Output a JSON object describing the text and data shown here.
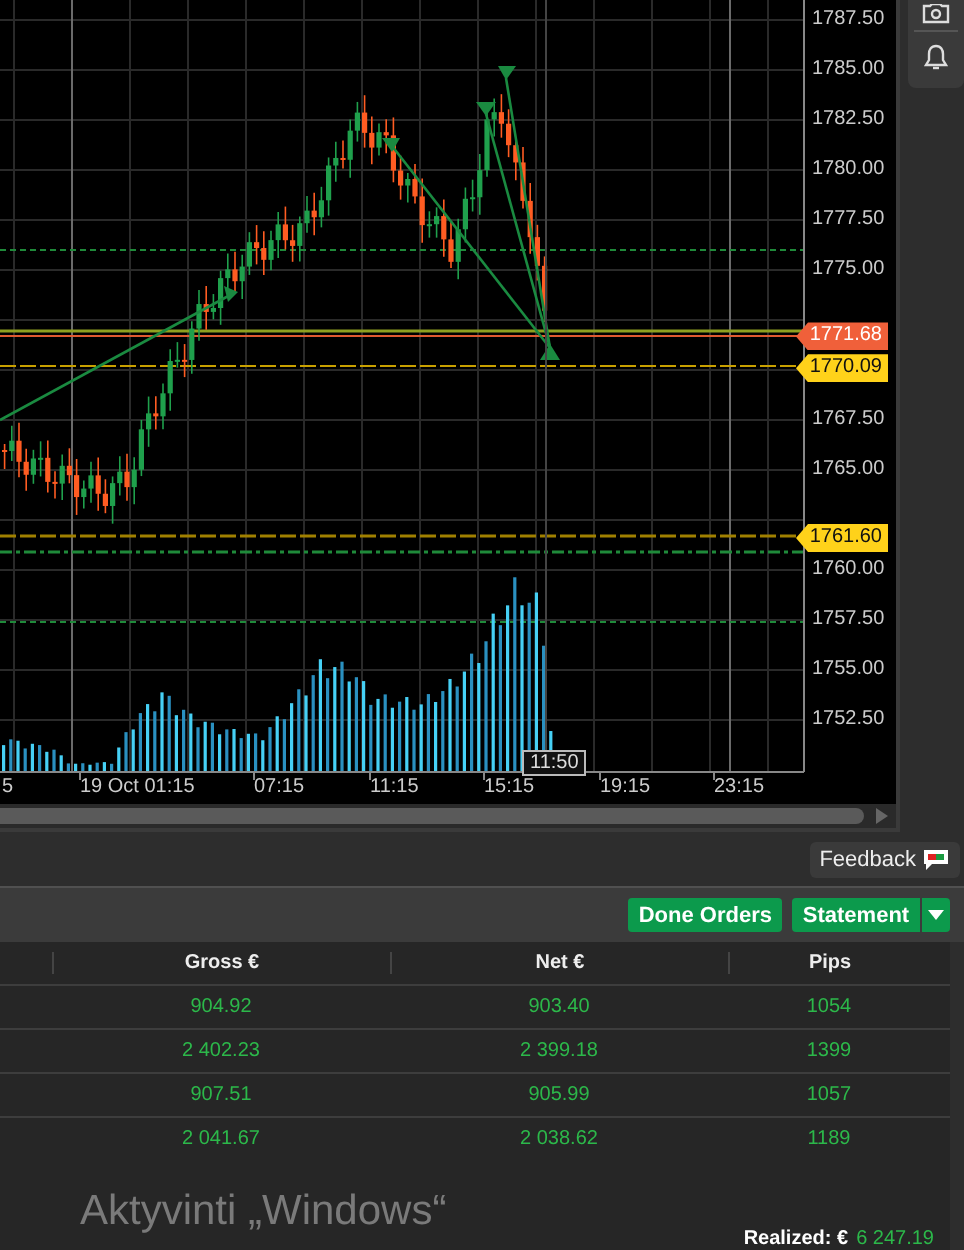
{
  "chart": {
    "price_labels": [
      "1787.50",
      "1785.00",
      "1782.50",
      "1780.00",
      "1777.50",
      "1775.00",
      "1767.50",
      "1765.00",
      "1760.00",
      "1757.50",
      "1755.00",
      "1752.50"
    ],
    "price_markers": [
      {
        "label": "1771.68",
        "kind": "bid"
      },
      {
        "label": "1770.09",
        "kind": "order"
      },
      {
        "label": "1761.60",
        "kind": "order"
      }
    ],
    "time_labels": [
      "5",
      "19 Oct 01:15",
      "07:15",
      "11:15",
      "15:15",
      "19:15",
      "23:15"
    ],
    "cursor_time": "11:50"
  },
  "feedback_button": {
    "label": "Feedback"
  },
  "orders_panel": {
    "buttons": [
      {
        "label": "Done Orders",
        "kind": "button"
      },
      {
        "label": "Statement",
        "kind": "split"
      }
    ],
    "columns": [
      "Gross €",
      "Net €",
      "Pips"
    ],
    "rows": [
      [
        "904.92",
        "903.40",
        "1054"
      ],
      [
        "2 402.23",
        "2 399.18",
        "1399"
      ],
      [
        "907.51",
        "905.99",
        "1057"
      ],
      [
        "2 041.67",
        "2 038.62",
        "1189"
      ]
    ],
    "realized": {
      "label": "Realized: €",
      "value": "6 247.19"
    }
  },
  "activation_notice": "Aktyvinti „Windows“"
}
